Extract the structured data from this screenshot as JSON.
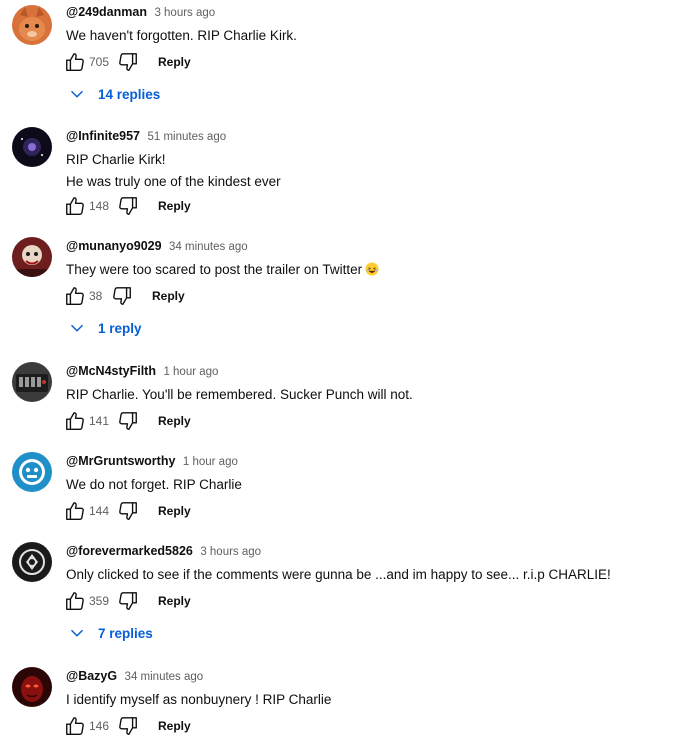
{
  "comments": [
    {
      "author": "@249danman",
      "time": "3 hours ago",
      "lines": [
        "We haven't forgotten. RIP Charlie Kirk."
      ],
      "likes": "705",
      "reply": "Reply",
      "replies": "14 replies"
    },
    {
      "author": "@Infinite957",
      "time": "51 minutes ago",
      "lines": [
        "RIP Charlie Kirk!",
        "He was truly one of the kindest ever"
      ],
      "likes": "148",
      "reply": "Reply"
    },
    {
      "author": "@munanyo9029",
      "time": "34 minutes ago",
      "lines": [
        "They were too scared to post the trailer on Twitter"
      ],
      "emoji": "laughing-emoji",
      "likes": "38",
      "reply": "Reply",
      "replies": "1 reply"
    },
    {
      "author": "@McN4styFilth",
      "time": "1 hour ago",
      "lines": [
        "RIP Charlie. You'll be remembered. Sucker Punch will not."
      ],
      "likes": "141",
      "reply": "Reply"
    },
    {
      "author": "@MrGruntsworthy",
      "time": "1 hour ago",
      "lines": [
        "We do not forget. RIP Charlie"
      ],
      "likes": "144",
      "reply": "Reply"
    },
    {
      "author": "@forevermarked5826",
      "time": "3 hours ago",
      "lines": [
        "Only clicked to see if the comments were gunna be ...and im happy to see... r.i.p CHARLIE!"
      ],
      "likes": "359",
      "reply": "Reply",
      "replies": "7 replies"
    },
    {
      "author": "@BazyG",
      "time": "34 minutes ago",
      "lines": [
        "I identify myself as nonbuynery ! RIP Charlie"
      ],
      "likes": "146",
      "reply": "Reply"
    }
  ],
  "icons": {
    "like": "thumbs-up-icon",
    "dislike": "thumbs-down-icon",
    "expand": "chevron-down-icon"
  },
  "colors": {
    "link": "#065fd4",
    "secondary": "#606060",
    "text": "#0f0f0f"
  }
}
